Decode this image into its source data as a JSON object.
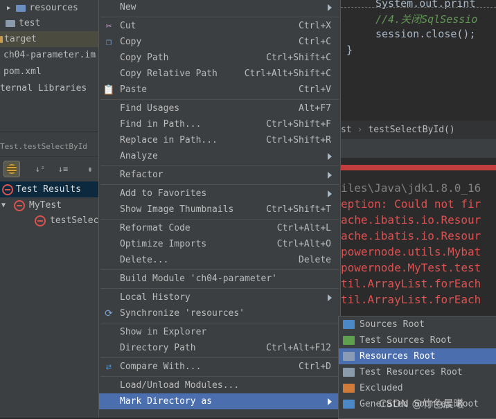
{
  "project_tree": [
    {
      "label": "resources",
      "folder_color": "#6a8fc0"
    },
    {
      "label": "test",
      "folder_color": "#8a9bab"
    },
    {
      "label": "target",
      "folder_color": "#c89b4e"
    },
    {
      "label": "ch04-parameter.im",
      "folder_color": ""
    },
    {
      "label": "pom.xml",
      "folder_color": ""
    },
    {
      "label": "ternal Libraries",
      "folder_color": ""
    }
  ],
  "run_panel": {
    "tab_label": "Test.testSelectById",
    "results_label": "Test Results",
    "tree": [
      "MyTest",
      "testSelec"
    ]
  },
  "editor": {
    "lines": [
      "System.out.print",
      "//4.关闭SqlSessio",
      "session.close();",
      "}"
    ],
    "breadcrumb": [
      "st",
      "testSelectById()"
    ],
    "console": [
      "iles\\Java\\jdk1.8.0_16",
      "eption: Could not fir",
      "ache.ibatis.io.Resour",
      "ache.ibatis.io.Resour",
      "powernode.utils.Mybat",
      "powernode.MyTest.test",
      "til.ArrayList.forEach",
      "til.ArrayList.forEach"
    ]
  },
  "context_menu": [
    {
      "label": "New",
      "shortcut": "",
      "submenu": true,
      "icon": ""
    },
    {
      "sep": true
    },
    {
      "label": "Cut",
      "shortcut": "Ctrl+X",
      "icon": "scissors-icon"
    },
    {
      "label": "Copy",
      "shortcut": "Ctrl+C",
      "icon": "copy-icon"
    },
    {
      "label": "Copy Path",
      "shortcut": "Ctrl+Shift+C",
      "icon": ""
    },
    {
      "label": "Copy Relative Path",
      "shortcut": "Ctrl+Alt+Shift+C",
      "icon": ""
    },
    {
      "label": "Paste",
      "shortcut": "Ctrl+V",
      "icon": "paste-icon"
    },
    {
      "sep": true
    },
    {
      "label": "Find Usages",
      "shortcut": "Alt+F7",
      "icon": ""
    },
    {
      "label": "Find in Path...",
      "shortcut": "Ctrl+Shift+F",
      "icon": ""
    },
    {
      "label": "Replace in Path...",
      "shortcut": "Ctrl+Shift+R",
      "icon": ""
    },
    {
      "label": "Analyze",
      "shortcut": "",
      "submenu": true,
      "icon": ""
    },
    {
      "sep": true
    },
    {
      "label": "Refactor",
      "shortcut": "",
      "submenu": true,
      "icon": ""
    },
    {
      "sep": true
    },
    {
      "label": "Add to Favorites",
      "shortcut": "",
      "submenu": true,
      "icon": ""
    },
    {
      "label": "Show Image Thumbnails",
      "shortcut": "Ctrl+Shift+T",
      "icon": ""
    },
    {
      "sep": true
    },
    {
      "label": "Reformat Code",
      "shortcut": "Ctrl+Alt+L",
      "icon": ""
    },
    {
      "label": "Optimize Imports",
      "shortcut": "Ctrl+Alt+O",
      "icon": ""
    },
    {
      "label": "Delete...",
      "shortcut": "Delete",
      "icon": ""
    },
    {
      "sep": true
    },
    {
      "label": "Build Module 'ch04-parameter'",
      "shortcut": "",
      "icon": ""
    },
    {
      "sep": true
    },
    {
      "label": "Local History",
      "shortcut": "",
      "submenu": true,
      "icon": ""
    },
    {
      "label": "Synchronize 'resources'",
      "shortcut": "",
      "icon": "sync-icon"
    },
    {
      "sep": true
    },
    {
      "label": "Show in Explorer",
      "shortcut": "",
      "icon": ""
    },
    {
      "label": "Directory Path",
      "shortcut": "Ctrl+Alt+F12",
      "icon": ""
    },
    {
      "sep": true
    },
    {
      "label": "Compare With...",
      "shortcut": "Ctrl+D",
      "icon": "compare-icon"
    },
    {
      "sep": true
    },
    {
      "label": "Load/Unload Modules...",
      "shortcut": "",
      "icon": ""
    },
    {
      "label": "Mark Directory as",
      "shortcut": "",
      "submenu": true,
      "highlighted": true,
      "icon": ""
    }
  ],
  "submenu": [
    {
      "label": "Sources Root",
      "color": "#4a88c7"
    },
    {
      "label": "Test Sources Root",
      "color": "#5fa04e"
    },
    {
      "label": "Resources Root",
      "color": "#8a9bb5",
      "highlighted": true
    },
    {
      "label": "Test Resources Root",
      "color": "#8a9bab"
    },
    {
      "label": "Excluded",
      "color": "#d17a3a"
    },
    {
      "label": "Generated Sources Root",
      "color": "#4a88c7"
    }
  ],
  "watermark": "CSDN @竹色晨曦"
}
